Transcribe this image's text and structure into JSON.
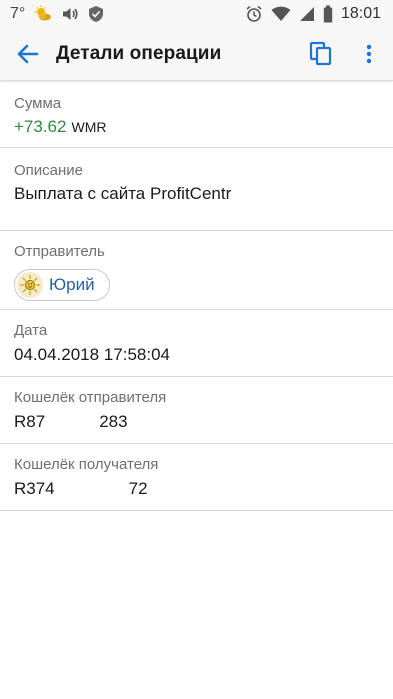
{
  "status_bar": {
    "temperature": "7°",
    "time": "18:01",
    "icons": [
      "weather-icon",
      "volume-icon",
      "shield-icon",
      "alarm-icon",
      "wifi-icon",
      "signal-icon",
      "battery-icon"
    ]
  },
  "app_bar": {
    "title": "Детали операции",
    "icons": [
      "back-arrow-icon",
      "copy-icon",
      "more-vert-icon"
    ]
  },
  "colors": {
    "accent": "#1976d2",
    "amount_positive": "#2e8b3a",
    "chip_text": "#2a5ea8"
  },
  "details": {
    "sum": {
      "label": "Сумма",
      "amount": "+73.62",
      "currency": "WMR"
    },
    "description": {
      "label": "Описание",
      "value": "Выплата с сайта ProfitCentr"
    },
    "sender": {
      "label": "Отправитель",
      "name": "Юрий",
      "avatar_icon": "sun-icon"
    },
    "date": {
      "label": "Дата",
      "value": "04.04.2018 17:58:04"
    },
    "sender_wallet": {
      "label": "Кошелёк отправителя",
      "value_start": "R87",
      "value_end": "283"
    },
    "receiver_wallet": {
      "label": "Кошелёк получателя",
      "value_start": "R374",
      "value_end": "72"
    }
  }
}
